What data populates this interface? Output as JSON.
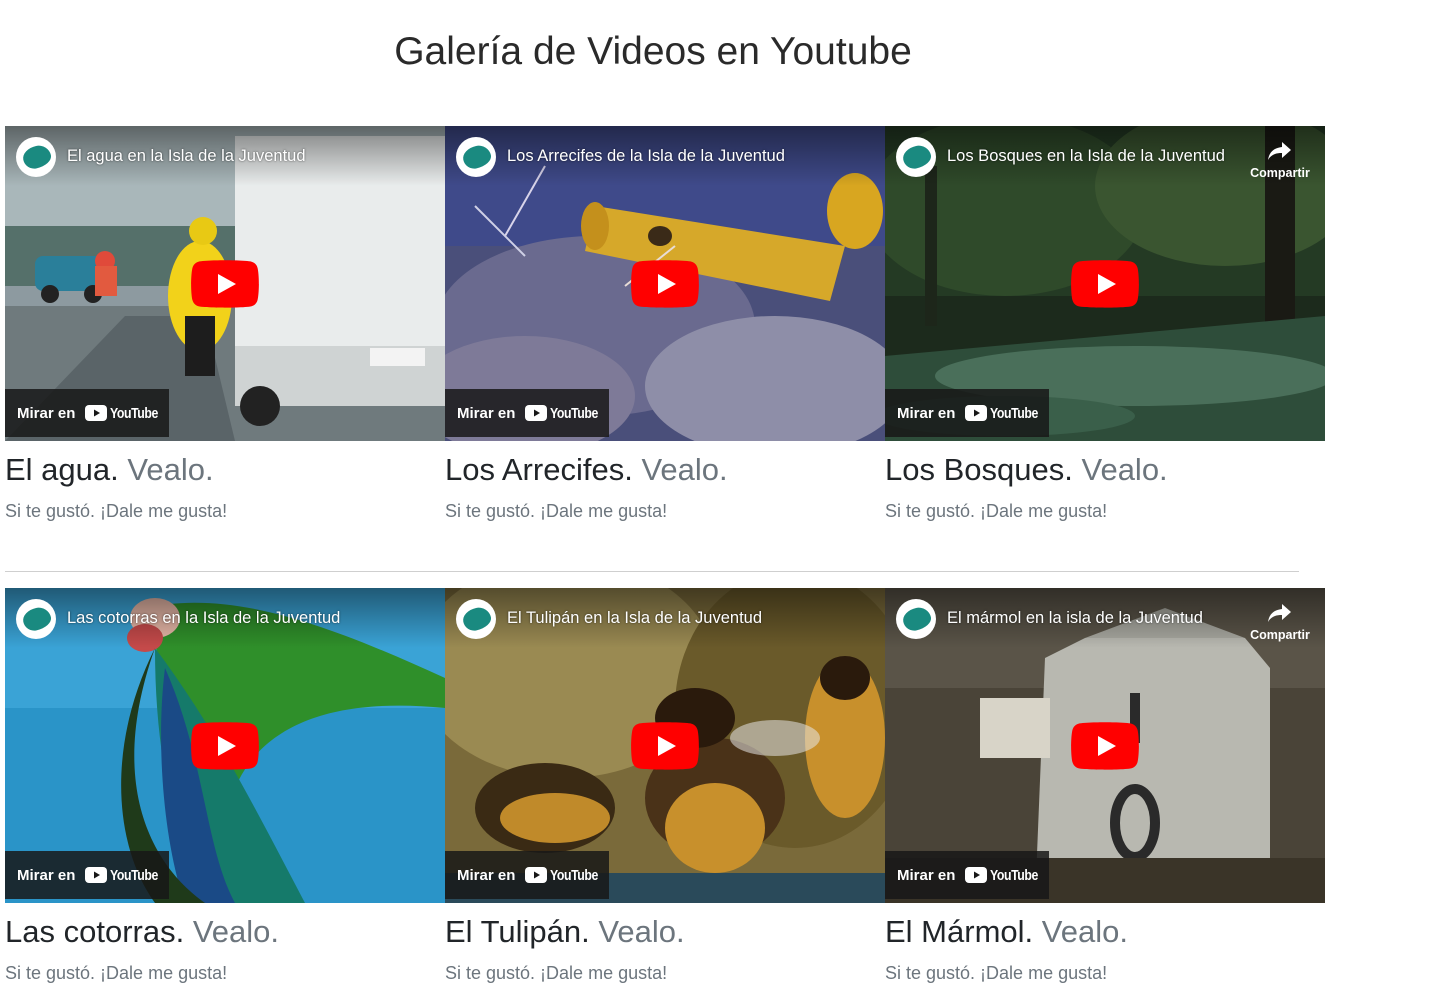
{
  "page": {
    "title": "Galería de Videos en Youtube"
  },
  "youtube": {
    "watch_on_label": "Mirar en",
    "logo_text": "YouTube",
    "share_label": "Compartir",
    "play_color": "#ff0000"
  },
  "videos": [
    {
      "video_title": "El agua en la Isla de la Juventud",
      "card_title": "El agua.",
      "card_link": "Vealo.",
      "card_text": "Si te gustó. ¡Dale me gusta!",
      "show_share": false,
      "scene": "rainy street with truck and cyclists"
    },
    {
      "video_title": "Los Arrecifes de la Isla de la Juventud",
      "card_title": "Los Arrecifes.",
      "card_link": "Vealo.",
      "card_text": "Si te gustó. ¡Dale me gusta!",
      "show_share": false,
      "scene": "yellow sponge on coral reef"
    },
    {
      "video_title": "Los Bosques en la Isla de la Juventud",
      "card_title": "Los Bosques.",
      "card_link": "Vealo.",
      "card_text": "Si te gustó. ¡Dale me gusta!",
      "show_share": true,
      "scene": "dark forest with stream"
    },
    {
      "video_title": "Las cotorras en la Isla de la Juventud",
      "card_title": "Las cotorras.",
      "card_link": "Vealo.",
      "card_text": "Si te gustó. ¡Dale me gusta!",
      "show_share": false,
      "scene": "green parrot flying against blue sky"
    },
    {
      "video_title": "El Tulipán en la Isla de la Juventud",
      "card_title": "El Tulipán.",
      "card_link": "Vealo.",
      "card_text": "Si te gustó. ¡Dale me gusta!",
      "show_share": false,
      "scene": "honey bees close-up"
    },
    {
      "video_title": "El mármol en la isla de la Juventud",
      "card_title": "El Mármol.",
      "card_link": "Vealo.",
      "card_text": "Si te gustó. ¡Dale me gusta!",
      "show_share": true,
      "scene": "marble kilometer marker stone"
    }
  ],
  "colors": {
    "heading": "#212529",
    "muted": "#6c757d",
    "channel_teal": "#1a8a80"
  }
}
